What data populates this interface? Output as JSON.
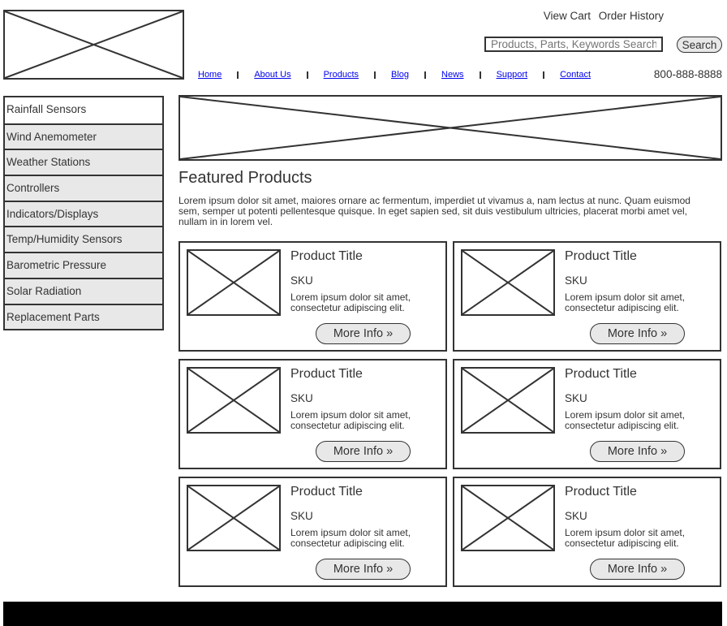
{
  "header": {
    "logo_icon": "image-placeholder-icon",
    "top_links": [
      "View Cart",
      "Order History"
    ],
    "search": {
      "placeholder": "Products, Parts, Keywords Search",
      "value": "Products, Parts, Keywords Search",
      "button_label": "Search"
    },
    "nav": [
      "Home",
      "About Us",
      "Products",
      "Blog",
      "News",
      "Support",
      "Contact"
    ],
    "phone": "800-888-8888",
    "link_color": "#0000ee"
  },
  "sidebar": {
    "items": [
      "Rainfall Sensors",
      "Wind Anemometer",
      "Weather Stations",
      "Controllers",
      "Indicators/Displays",
      "Temp/Humidity Sensors",
      "Barometric Pressure",
      "Solar Radiation",
      "Replacement Parts"
    ]
  },
  "main": {
    "banner_icon": "image-placeholder-icon",
    "featured_title": "Featured Products",
    "featured_desc": "Lorem ipsum dolor sit amet, maiores ornare ac fermentum, imperdiet ut vivamus a, nam lectus at nunc. Quam euismod sem, semper ut potenti pellentesque quisque. In eget sapien sed, sit duis vestibulum ultricies, placerat morbi amet vel, nullam in in lorem vel.",
    "products": [
      {
        "title": "Product Title",
        "sku": "SKU",
        "desc_line1": "Lorem ipsum dolor sit amet,",
        "desc_line2": "consectetur adipiscing elit.",
        "button": "More Info »"
      },
      {
        "title": "Product Title",
        "sku": "SKU",
        "desc_line1": "Lorem ipsum dolor sit amet,",
        "desc_line2": "consectetur adipiscing elit.",
        "button": "More Info »"
      },
      {
        "title": "Product Title",
        "sku": "SKU",
        "desc_line1": "Lorem ipsum dolor sit amet,",
        "desc_line2": "consectetur adipiscing elit.",
        "button": "More Info »"
      },
      {
        "title": "Product Title",
        "sku": "SKU",
        "desc_line1": "Lorem ipsum dolor sit amet,",
        "desc_line2": "consectetur adipiscing elit.",
        "button": "More Info »"
      },
      {
        "title": "Product Title",
        "sku": "SKU",
        "desc_line1": "Lorem ipsum dolor sit amet,",
        "desc_line2": "consectetur adipiscing elit.",
        "button": "More Info »"
      },
      {
        "title": "Product Title",
        "sku": "SKU",
        "desc_line1": "Lorem ipsum dolor sit amet,",
        "desc_line2": "consectetur adipiscing elit.",
        "button": "More Info »"
      }
    ]
  }
}
